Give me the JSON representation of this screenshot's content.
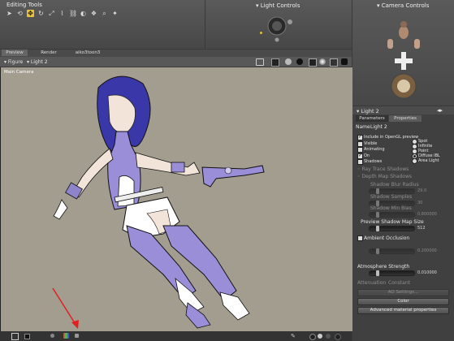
{
  "editing_tools": {
    "title": "Editing Tools",
    "icons": [
      "arrow-select-icon",
      "rotate-icon",
      "translate-icon",
      "twist-icon",
      "scale-icon",
      "taper-icon",
      "chain-icon",
      "color-icon",
      "grouping-icon",
      "magnify-icon",
      "morph-icon"
    ]
  },
  "light_controls": {
    "title": "Light Controls"
  },
  "camera_controls": {
    "title": "Camera Controls"
  },
  "document_tabs": {
    "preview": "Preview",
    "render": "Render",
    "doc": "aiko3toon3"
  },
  "figure_bar": {
    "figure": "Figure",
    "light": "Light 2"
  },
  "viewport": {
    "camera_label": "Main Camera"
  },
  "properties": {
    "header": "Light 2",
    "tab_parameters": "Parameters",
    "tab_properties": "Properties",
    "name_label": "Name",
    "name_value": "Light 2",
    "checkboxes": [
      {
        "label": "Include in OpenGL preview",
        "checked": true
      },
      {
        "label": "Visible",
        "checked": false
      },
      {
        "label": "Animating",
        "checked": false
      },
      {
        "label": "On",
        "checked": true
      },
      {
        "label": "Shadows",
        "checked": false
      }
    ],
    "light_types": [
      {
        "label": "Spot",
        "selected": false
      },
      {
        "label": "Infinite",
        "selected": false
      },
      {
        "label": "Point",
        "selected": false
      },
      {
        "label": "Diffuse IBL",
        "selected": true
      },
      {
        "label": "Area Light",
        "selected": false
      }
    ],
    "ray_trace": "Ray Trace Shadows",
    "depth_map": "Depth Map Shadows",
    "shadow_blur_radius": {
      "label": "Shadow Blur Radius",
      "value": "29.0"
    },
    "shadow_samples": {
      "label": "Shadow Samples",
      "value": "30"
    },
    "shadow_min_bias": {
      "label": "Shadow Min Bias",
      "value": "0.800000"
    },
    "preview_map_size": {
      "label": "Preview Shadow Map Size",
      "value": "512"
    },
    "ambient_occlusion": {
      "label": "Ambient Occlusion",
      "checked": false
    },
    "ao_value": "0.200000",
    "atmosphere": {
      "label": "Atmosphere Strength",
      "value": "0.010000"
    },
    "attenuation_label": "Attenuation",
    "attenuation_value": "Constant",
    "btn_ao_settings": "AO Settings...",
    "btn_color": "Color",
    "btn_advanced": "Advanced material properties"
  },
  "bottom_bar": {
    "icons": [
      "play-icon",
      "frame-icon",
      "options-icon",
      "arrow-icon"
    ]
  }
}
